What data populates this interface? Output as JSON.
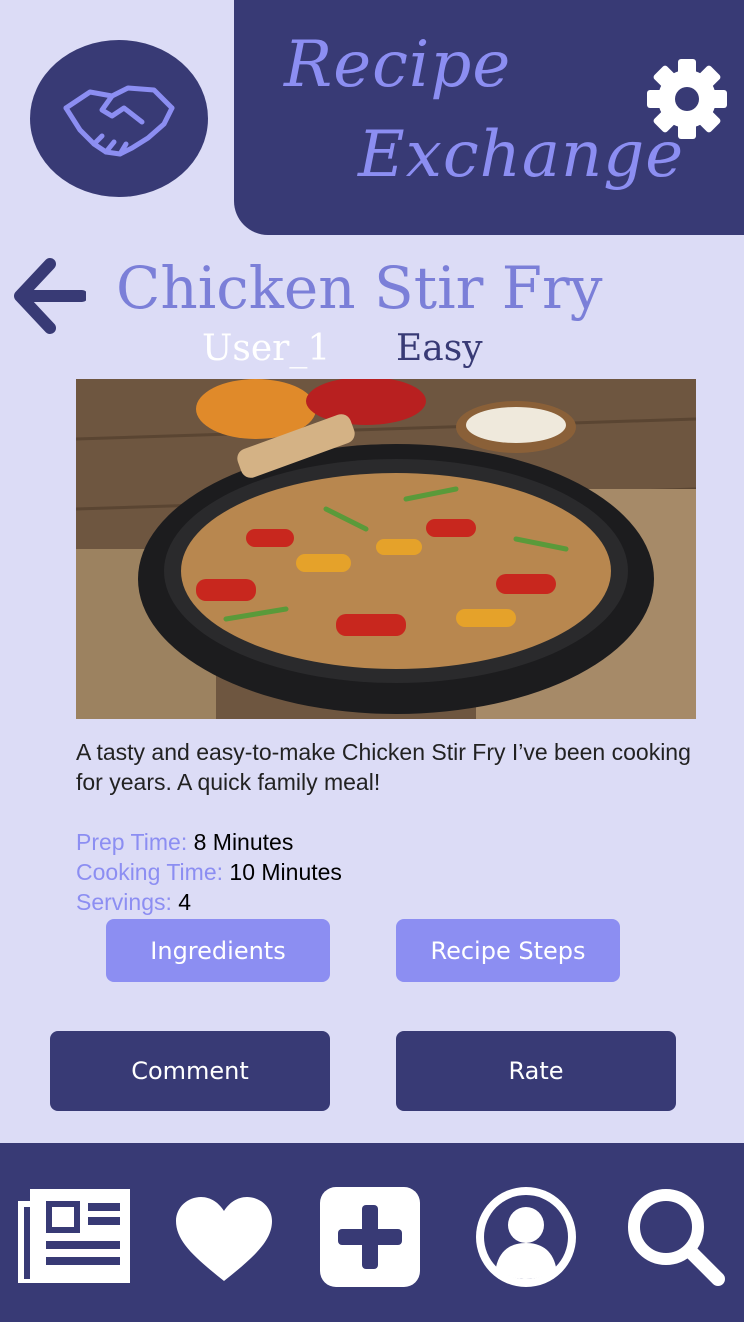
{
  "app": {
    "brand_line1": "Recipe",
    "brand_line2": "Exchange"
  },
  "recipe": {
    "title": "Chicken Stir Fry",
    "author": "User_1",
    "difficulty": "Easy",
    "description": "A tasty and easy-to-make Chicken Stir Fry I’ve been cooking for years. A quick family meal!",
    "prep_label": "Prep Time:",
    "prep_value": "8 Minutes",
    "cook_label": "Cooking Time:",
    "cook_value": "10 Minutes",
    "servings_label": "Servings:",
    "servings_value": "4"
  },
  "buttons": {
    "ingredients": "Ingredients",
    "steps": "Recipe Steps",
    "comment": "Comment",
    "rate": "Rate"
  },
  "icons": {
    "logo": "handshake-icon",
    "settings": "gear-icon",
    "back": "back-arrow-icon",
    "nav": [
      "newspaper-icon",
      "heart-icon",
      "plus-icon",
      "profile-icon",
      "search-icon"
    ]
  },
  "colors": {
    "primary": "#383a75",
    "accent": "#8c8ef2",
    "background": "#dcdcf6",
    "title": "#7b7fd8"
  }
}
